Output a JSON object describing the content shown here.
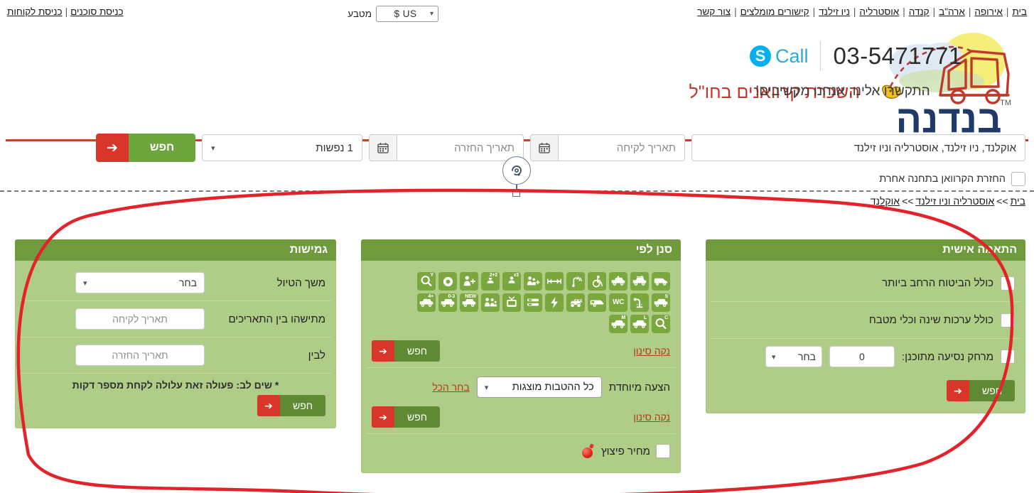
{
  "topbar": {
    "nav_links": [
      {
        "label": "בית"
      },
      {
        "label": "אירופה"
      },
      {
        "label": "ארה\"ב"
      },
      {
        "label": "קנדה"
      },
      {
        "label": "אוסטרליה"
      },
      {
        "label": "ניו זילנד"
      },
      {
        "label": "קישורים מומלצים"
      },
      {
        "label": "צור קשר"
      }
    ],
    "separator": "|",
    "currency_label": "מטבע",
    "currency_value": "US $",
    "login_agents": "כניסת סוכנים",
    "login_customers": "כניסת לקוחות"
  },
  "header": {
    "tagline": "השכרת קרוואנים בחו\"ל",
    "logo_text": "בנדנה",
    "logo_tm": "TM",
    "skype_label": "Call",
    "phone": "03-5471771",
    "call_text": "התקשרו אלינו, אנחנו מקשיבים!"
  },
  "search": {
    "location_value": "אוקלנד, ניו זילנד, אוסטרליה וניו זילנד",
    "pickup_placeholder": "תאריך לקיחה",
    "return_placeholder": "תאריך החזרה",
    "pax_value": "1 נפשות",
    "search_label": "חפש",
    "calendar_icon": "calendar-icon",
    "swap_icon": "rotate-icon",
    "return_other_station": "החזרת הקרוואן בתחנה אחרת"
  },
  "breadcrumb": {
    "items": [
      {
        "label": "בית"
      },
      {
        "label": "אוסטרליה וניו זילנד"
      },
      {
        "label": "אוקלנד"
      }
    ],
    "separator": ">>"
  },
  "panels": {
    "flexibility": {
      "title": "גמישות",
      "trip_length_label": "משך הטיול",
      "trip_length_value": "בחר",
      "between_label": "מתישהו בין התאריכים",
      "between_placeholder": "תאריך לקיחה",
      "to_label": "לבין",
      "to_placeholder": "תאריך החזרה",
      "note": "* שים לב: פעולה זאת עלולה לקחת מספר דקות",
      "search_label": "חפש"
    },
    "filter": {
      "title": "סנן לפי",
      "icons_row1": [
        {
          "name": "van-icon",
          "tag": ""
        },
        {
          "name": "van-arrow-icon",
          "tag": ""
        },
        {
          "name": "van-plus-icon",
          "tag": ""
        },
        {
          "name": "wheelchair-icon",
          "tag": ""
        },
        {
          "name": "automatic-transmission-icon",
          "tag": "A"
        },
        {
          "name": "bed-length-icon",
          "tag": ""
        },
        {
          "name": "family-plus-icon",
          "tag": ""
        },
        {
          "name": "berth-x3-icon",
          "tag": "x3"
        },
        {
          "name": "berth-2plus2-icon",
          "tag": "2+2"
        },
        {
          "name": "person-plus-icon",
          "tag": ""
        },
        {
          "name": "ring-icon",
          "tag": ""
        },
        {
          "name": "quality-y-icon",
          "tag": "Y"
        }
      ],
      "icons_row2": [
        {
          "name": "van-s-icon",
          "tag": "S"
        },
        {
          "name": "shower-icon",
          "tag": ""
        },
        {
          "name": "wc-icon",
          "tag": "WC"
        },
        {
          "name": "caravan-trailer-icon",
          "tag": ""
        },
        {
          "name": "four-by-four-icon",
          "tag": "4X4"
        },
        {
          "name": "electricity-icon",
          "tag": ""
        },
        {
          "name": "bunk-bed-icon",
          "tag": ""
        },
        {
          "name": "tv-icon",
          "tag": ""
        },
        {
          "name": "family-icon",
          "tag": ""
        },
        {
          "name": "van-new-icon",
          "tag": "NEW"
        },
        {
          "name": "van-0-3-icon",
          "tag": "0-3"
        },
        {
          "name": "van-plus4-icon",
          "tag": "+4"
        }
      ],
      "icons_row3": [
        {
          "name": "quality-c-icon",
          "tag": "C"
        },
        {
          "name": "van-l-icon",
          "tag": "L"
        },
        {
          "name": "van-m-icon",
          "tag": "M"
        }
      ],
      "clear_filter_label": "נקה סינון",
      "search_label": "חפש",
      "special_offer_label": "הצעה מיוחדת",
      "special_select_value": "כל ההטבות מוצגות",
      "select_all_label": "בחר הכל",
      "clear_filter_label2": "נקה סינון",
      "search_label2": "חפש",
      "bomb_price_label": "מחיר פיצוץ",
      "bomb_icon": "bomb-icon"
    },
    "personalize": {
      "title": "התאמה אישית",
      "insurance_label": "כולל הביטוח הרחב ביותר",
      "kitchen_label": "כולל ערכות שינה וכלי מטבח",
      "distance_label": "מרחק נסיעה מתוכנן:",
      "distance_value": "0",
      "distance_unit": "בחר",
      "search_label": "חפש"
    }
  },
  "colors": {
    "panel_header_green": "#6f9b3c",
    "panel_body_green": "#afcd87",
    "icon_green": "#7ba73f",
    "button_green": "#6da43b",
    "button_red": "#d9362b",
    "brand_red": "#b9472b",
    "link_red": "#b23b1e",
    "annotation_red": "#e2232a",
    "skype_blue": "#00aff0"
  }
}
